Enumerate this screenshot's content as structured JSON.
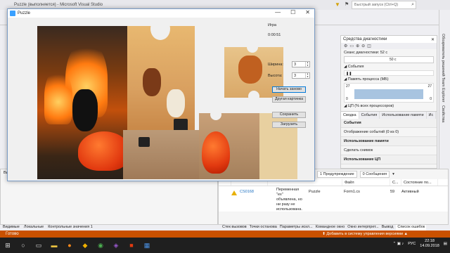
{
  "vs": {
    "title": "Puzzle (выполняется) - Microsoft Visual Studio",
    "quicklaunch_placeholder": "Быстрый запуск (Ctrl+Q)",
    "right_tabs": [
      "Обозреватель решений",
      "Team Explorer",
      "Свойства"
    ]
  },
  "diagnostics": {
    "title": "Средства диагностики",
    "session": "Сеанс диагностики: 52 с",
    "timeline_label": "50 с",
    "events_label": "◢ События",
    "memory_label": "◢ Память процесса (МБ)",
    "mem_left_top": "27",
    "mem_right_top": "27",
    "mem_left_bottom": "0",
    "mem_right_bottom": "0",
    "cpu_label": "◢ ЦП (% всех процессоров)",
    "tabs": [
      "Сводка",
      "События",
      "Использование памяти",
      "Ис"
    ],
    "events_header": "События",
    "events_row": "Отображение событий (0 из 0)",
    "memory_header": "Использование памяти",
    "memory_row": "Сделать снимок",
    "cpu_header": "Использование ЦП"
  },
  "errlist": {
    "warnings": "1 Предупреждение",
    "messages": "0 Сообщения",
    "cols": [
      "",
      "",
      "",
      "Файл",
      "С...",
      "Состояние по..."
    ],
    "row": {
      "code": "CS0168",
      "desc": "Переменная \"ex\" объявлена, но ни разу не использована.",
      "project": "Puzzle",
      "file": "Form1.cs",
      "line": "59",
      "state": "Активный"
    }
  },
  "left_panel_title": "Ви",
  "bottom_tabs_left": [
    "Видимые",
    "Локальные",
    "Контрольные значения 1"
  ],
  "bottom_tabs_right": [
    "Стек вызовов",
    "Точки останова",
    "Параметры искл...",
    "Командное окно",
    "Окно интерпрет...",
    "Вывод",
    "Список ошибок"
  ],
  "status": {
    "left": "Готово",
    "right": "⬆ Добавить в систему управления версиями ▲"
  },
  "taskbar": {
    "lang": "РУС",
    "time": "22:18",
    "date": "14.09.2018"
  },
  "puzzle": {
    "title": "Puzzle",
    "group": "Игра",
    "timer": "0:00:51",
    "width_label": "Ширина:",
    "width_value": "3",
    "height_label": "Высота:",
    "height_value": "3",
    "btn_restart": "Начать заново",
    "btn_other": "Другая картинка",
    "btn_save": "Сохранить",
    "btn_load": "Загрузить"
  }
}
